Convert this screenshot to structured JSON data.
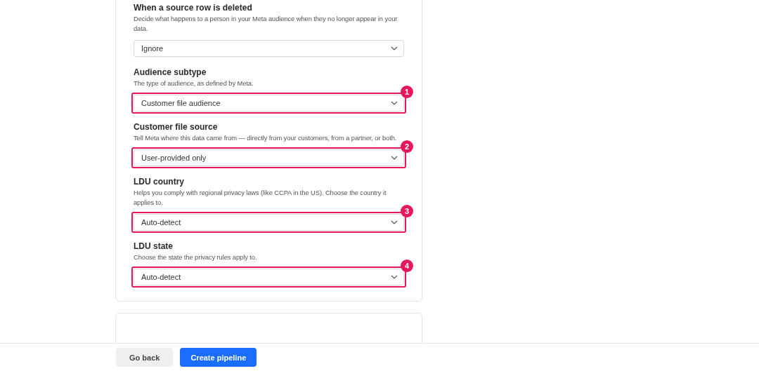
{
  "sections": [
    {
      "title": "When a source row is deleted",
      "description": "Decide what happens to a person in your Meta audience when they no longer appear in your data.",
      "value": "Ignore"
    },
    {
      "title": "Audience subtype",
      "description": "The type of audience, as defined by Meta.",
      "value": "Customer file audience",
      "annotation": "1"
    },
    {
      "title": "Customer file source",
      "description": "Tell Meta where this data came from — directly from your customers, from a partner, or both.",
      "value": "User-provided only",
      "annotation": "2"
    },
    {
      "title": "LDU country",
      "description": "Helps you comply with regional privacy laws (like CCPA in the US). Choose the country it applies to.",
      "value": "Auto-detect",
      "annotation": "3"
    },
    {
      "title": "LDU state",
      "description": "Choose the state the privacy rules apply to.",
      "value": "Auto-detect",
      "annotation": "4"
    }
  ],
  "footer": {
    "buttons": [
      {
        "label": "Go back",
        "kind": "secondary"
      },
      {
        "label": "Create pipeline",
        "kind": "primary"
      }
    ]
  }
}
